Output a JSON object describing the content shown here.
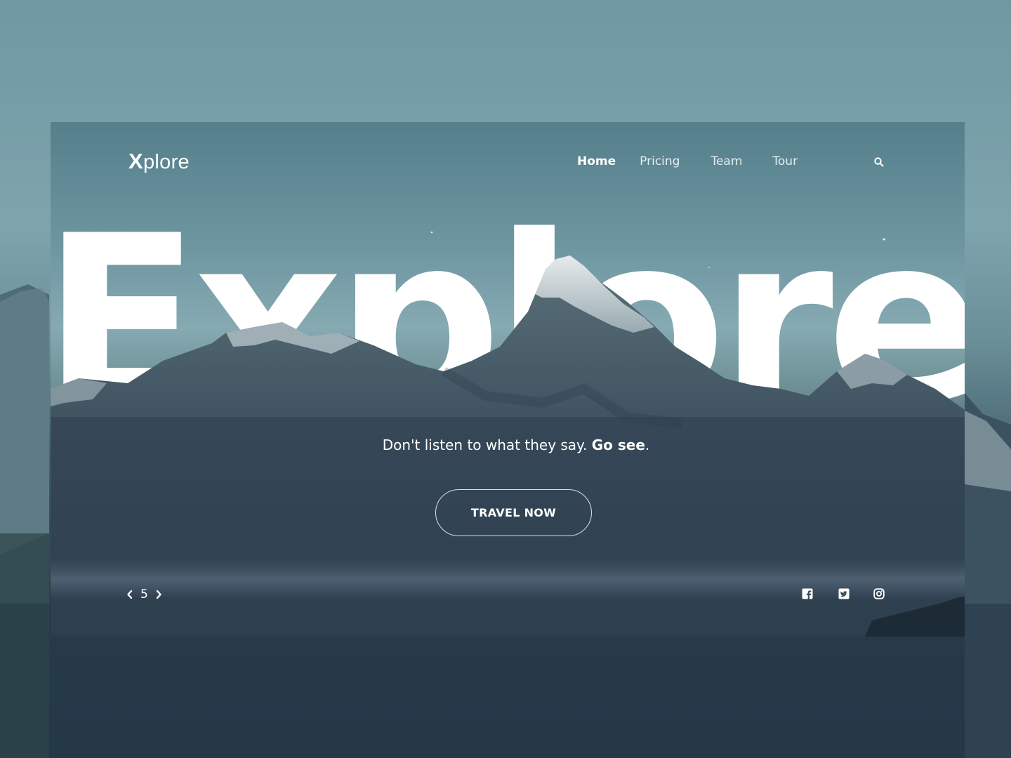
{
  "brand": {
    "logo_initial": "X",
    "logo_rest": "plore"
  },
  "nav": {
    "items": [
      {
        "label": "Home",
        "active": true
      },
      {
        "label": "Pricing",
        "active": false
      },
      {
        "label": "Team",
        "active": false
      },
      {
        "label": "Tour",
        "active": false
      }
    ],
    "search_icon": "search-icon"
  },
  "hero": {
    "headline": "Explore",
    "tagline_regular": "Don't listen to what they say. ",
    "tagline_bold": "Go see",
    "tagline_end": ".",
    "cta_label": "TRAVEL NOW"
  },
  "pager": {
    "current": "5",
    "prev_icon": "chevron-left-icon",
    "next_icon": "chevron-right-icon"
  },
  "social": [
    "facebook-icon",
    "twitter-icon",
    "instagram-icon"
  ],
  "colors": {
    "text": "#ffffff",
    "sky": "#7ea4ad",
    "mountain_dark": "#2b3c4b",
    "snow": "#e8eef0"
  }
}
